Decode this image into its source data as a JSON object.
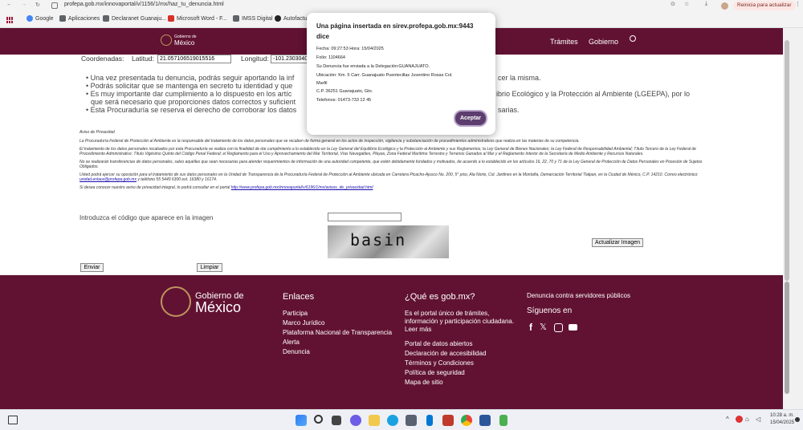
{
  "browser": {
    "url": "profepa.gob.mx/innovaportal/v/1156/1/mx/haz_tu_denuncia.html",
    "restart_label": "Reinicia para actualizar"
  },
  "bookmarks": [
    {
      "label": "Google",
      "icon": "google-icon",
      "color": "#4285f4"
    },
    {
      "label": "Aplicaciones",
      "icon": "apps-grid-icon",
      "color": "#5f6368"
    },
    {
      "label": "Declaranet Guanaju...",
      "icon": "folder-icon",
      "color": "#5f6368"
    },
    {
      "label": "Microsoft Word - F...",
      "icon": "word-doc-icon",
      "color": "#d93025"
    },
    {
      "label": "IMSS Digital",
      "icon": "folder-icon",
      "color": "#5f6368"
    },
    {
      "label": "Autofactu",
      "icon": "autofactura-icon",
      "color": "#222"
    }
  ],
  "header": {
    "logo_line1": "Gobierno de",
    "logo_line2": "México",
    "nav": [
      "Trámites",
      "Gobierno"
    ]
  },
  "form": {
    "coords_label": "Coordenadas:",
    "lat_label": "Latitud:",
    "lat_value": "21.057106519015516",
    "lon_label": "Longitud:",
    "lon_value": "-101.2303040"
  },
  "bullets": [
    "Una vez presentada tu denuncia, podrás seguir aportando la inf",
    "Podrás solicitar que se mantenga en secreto tu identidad y que",
    "Es muy importante dar cumplimiento a lo dispuesto en los artíc",
    "que será necesario que proporciones datos correctos y suficient",
    "Esta Procuraduría se reserva el derecho de corroborar los datos"
  ],
  "bullets_right": [
    "cer la misma.",
    "ibrio Ecológico y la Protección al Ambiente (LGEEPA), por lo",
    "sarias."
  ],
  "privacy": {
    "title": "Aviso de Privacidad",
    "p1": "La Procuraduría Federal de Protección al Ambiente es la responsable del tratamiento de los datos personales que se recaben de forma general en los actos de inspección, vigilancia y substanciación de procedimientos administrativos que realiza en las materias de su competencia.",
    "p2": "El tratamiento de los datos personales recabados por esta Procuraduría se realiza con la finalidad de dar cumplimiento a lo establecido en la Ley General del Equilibrio Ecológico y la Protección al Ambiente y sus Reglamentos; la Ley General de Bienes Nacionales; la Ley Federal de Responsabilidad Ambiental; Título Tercero de la Ley Federal de Procedimiento Administrativo; Título Vigésimo Quinto del Código Penal Federal; el Reglamento para el Uso y Aprovechamiento del Mar Territorial, Vías Navegables, Playas, Zona Federal Marítimo Terrestre y Terrenos Ganados al Mar y el Reglamento Interior de la Secretaría de Medio Ambiente y Recursos Naturales.",
    "p3": "No se realizarán transferencias de datos personales, salvo aquéllas que sean necesarias para atender requerimientos de información de una autoridad competente, que estén debidamente fundados y motivados, de acuerdo a lo establecido en los artículos 16, 22, 70 y 71 de la Ley General de Protección de Datos Personales en Posesión de Sujetos Obligados.",
    "p4a": "Usted podrá ejercer su oposición para el tratamiento de sus datos personales en la Unidad de Transparencia de la Procuraduría Federal de Protección al Ambiente ubicada en Carretera Picacho-Ajusco No. 200, 5° piso, Ala Norte, Col. Jardines en la Montaña, Demarcación Territorial Tlalpan, en la Ciudad de México, C.P. 14210. Correo electrónico:",
    "p4_email": "unidad.enlace@profepa.gob.mx",
    "p4b": "y teléfono 55 5449 6300 ext. 16380 y 16174.",
    "p5a": "Si desea conocer nuestro aviso de privacidad integral, lo podrá consultar en el portal",
    "p5_link": "http://www.profepa.gob.mx/innovaportal/v/6196/1/mx/avisos_de_privacidad.html"
  },
  "captcha": {
    "label": "Introduzca el código que aparece en la imagen",
    "text": "basin",
    "refresh_label": "Actualizar Imagen"
  },
  "buttons": {
    "send": "Enviar",
    "clear": "Limpiar"
  },
  "dialog": {
    "title_line1": "Una página insertada en sirev.profepa.gob.mx:9443",
    "title_line2": "dice",
    "line1": "Fecha: 09:27:53  Hora: 15/04/2025",
    "line2": "Folio: 1104664",
    "line3": "Su Denuncia fue enviada a la Delegación:GUANAJUATO.",
    "line4": "Ubicación: Km. 5 Carr. Guanajuato  Puentecillas Juventino Rosas Col.",
    "line5": "Marfil",
    "line6": "C.P. 36251 Guanajuato, Gto.",
    "line7": "Telefonos: 01473-733 12 45",
    "accept": "Aceptar"
  },
  "footer": {
    "logo_line1": "Gobierno de",
    "logo_line2": "México",
    "enlaces_title": "Enlaces",
    "enlaces": [
      "Participa",
      "Marco Jurídico",
      "Plataforma Nacional de Transparencia",
      "Alerta",
      "Denuncia"
    ],
    "que_title": "¿Qué es gob.mx?",
    "que_text1": "Es el portal único de trámites,",
    "que_text2": "información y participación ciudadana.",
    "que_more": "Leer más",
    "que_links": [
      "Portal de datos abiertos",
      "Declaración de accesibilidad",
      "Términos y Condiciones",
      "Política de seguridad",
      "Mapa de sitio"
    ],
    "denuncia_link": "Denuncia contra servidores públicos",
    "siguenos": "Síguenos en"
  },
  "taskbar": {
    "time": "10:28 a. m.",
    "date": "15/04/2025"
  },
  "colors": {
    "gov_maroon": "#611232",
    "gold": "#bc955c",
    "dialog_button": "#5c3d6e"
  }
}
